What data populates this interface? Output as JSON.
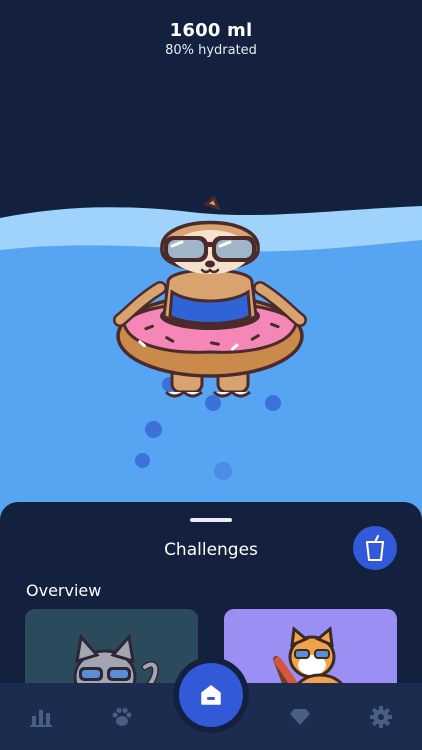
{
  "header": {
    "volume": "1600 ml",
    "hydration": "80% hydrated"
  },
  "sheet": {
    "title": "Challenges",
    "section": "Overview",
    "cards": [
      {
        "name": "cat-with-sunglasses"
      },
      {
        "name": "shiba-on-beach-chair"
      }
    ]
  },
  "icons": {
    "cup": "cup-icon",
    "home": "home-icon",
    "tabs": [
      "stats-icon",
      "paw-icon",
      "diamond-icon",
      "settings-icon"
    ]
  },
  "colors": {
    "background": "#13213f",
    "water": "#57a4f2",
    "wave": "#9fd3fb",
    "accent": "#3259d8",
    "card_teal": "#2b4b5d",
    "card_purple": "#9c8ff3",
    "tab_icon": "#4a5d84"
  }
}
